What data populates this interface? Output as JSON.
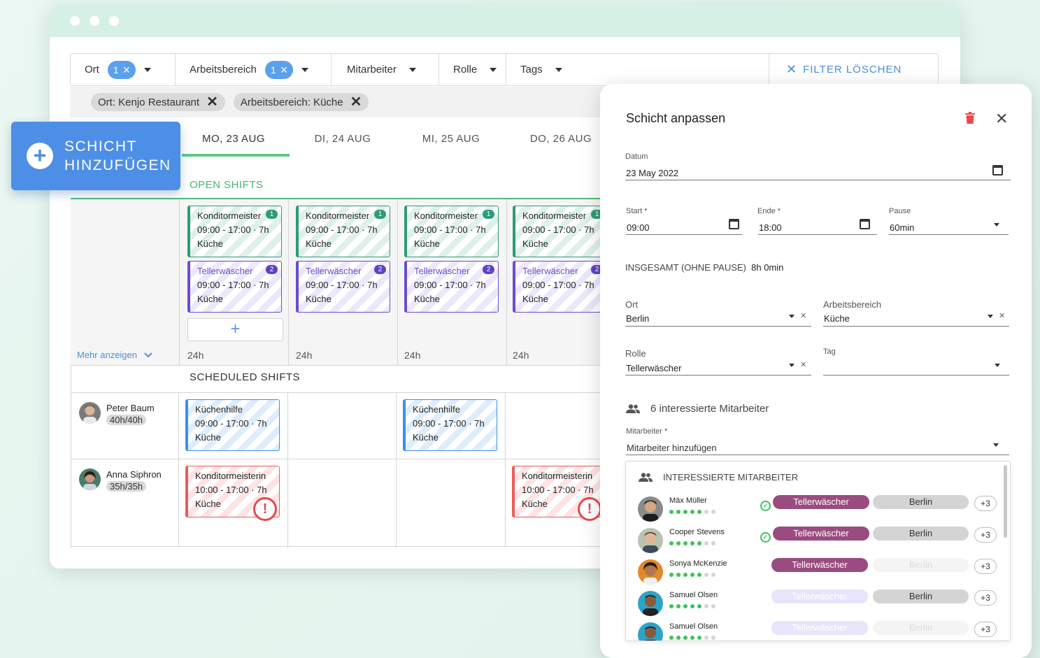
{
  "filters": {
    "ort_label": "Ort",
    "ort_count": "1",
    "arbeitsbereich_label": "Arbeitsbereich",
    "arbeitsbereich_count": "1",
    "mitarbeiter_label": "Mitarbeiter",
    "rolle_label": "Rolle",
    "tags_label": "Tags",
    "clear_label": "FILTER LÖSCHEN"
  },
  "chips": [
    "Ort: Kenjo Restaurant",
    "Arbeitsbereich: Küche"
  ],
  "add_shift": {
    "line1": "SCHICHT",
    "line2": "HINZUFÜGEN"
  },
  "days": [
    "MO, 23 AUG",
    "DI, 24 AUG",
    "MI, 25 AUG",
    "DO, 26 AUG"
  ],
  "open_shifts_label": "OPEN SHIFTS",
  "scheduled_shifts_label": "SCHEDULED SHIFTS",
  "more_label": "Mehr anzeigen",
  "day_total": "24h",
  "open_shifts": [
    {
      "title": "Konditormeister",
      "count": "1",
      "time": "09:00 - 17:00 · 7h",
      "area": "Küche"
    },
    {
      "title": "Tellerwäscher",
      "count": "2",
      "time": "09:00 - 17:00 · 7h",
      "area": "Küche"
    }
  ],
  "employees": [
    {
      "name": "Peter Baum",
      "hours": "40h/40h",
      "shift": {
        "title": "Küchenhilfe",
        "time": "09:00 - 17:00 · 7h",
        "area": "Küche"
      }
    },
    {
      "name": "Anna Siphron",
      "hours": "35h/35h",
      "shift": {
        "title": "Konditormeisterin",
        "time": "10:00 - 17:00 · 7h",
        "area": "Küche"
      }
    }
  ],
  "panel": {
    "title": "Schicht anpassen",
    "datum_label": "Datum",
    "datum_value": "23 May 2022",
    "start_label": "Start *",
    "start_value": "09:00",
    "ende_label": "Ende *",
    "ende_value": "18:00",
    "pause_label": "Pause",
    "pause_value": "60min",
    "total_label": "INSGESAMT (OHNE PAUSE)",
    "total_value": "8h 0min",
    "ort_label": "Ort",
    "ort_value": "Berlin",
    "bereich_label": "Arbeitsbereich",
    "bereich_value": "Küche",
    "rolle_label": "Rolle",
    "rolle_value": "Tellerwäscher",
    "tag_label": "Tag",
    "interested_count_text": "6 interessierte Mitarbeiter",
    "mitarbeiter_label": "Mitarbeiter *",
    "mitarbeiter_placeholder": "Mitarbeiter hinzufügen",
    "list_header": "INTERESSIERTE MITARBEITER",
    "candidates": [
      {
        "name": "Mäx Müller",
        "rating": 5,
        "checked": true,
        "role": "Tellerwäscher",
        "location": "Berlin",
        "extra": "+3"
      },
      {
        "name": "Cooper Stevens",
        "rating": 5,
        "checked": true,
        "role": "Tellerwäscher",
        "location": "Berlin",
        "extra": "+3"
      },
      {
        "name": "Sonya McKenzie",
        "rating": 5,
        "checked": false,
        "role": "Tellerwäscher",
        "location": "Berlin",
        "extra": "+3"
      },
      {
        "name": "Samuel Olsen",
        "rating": 5,
        "checked": false,
        "role": "Tellerwäscher",
        "location": "Berlin",
        "extra": "+3"
      },
      {
        "name": "Samuel Olsen",
        "rating": 5,
        "checked": false,
        "role": "Tellerwäscher",
        "location": "Berlin",
        "extra": "+3"
      }
    ]
  },
  "colors": {
    "accent": "#4d8ee6",
    "open_green": "#45b56b",
    "role_tag": "#9a4b7f",
    "warn": "#e94848"
  }
}
